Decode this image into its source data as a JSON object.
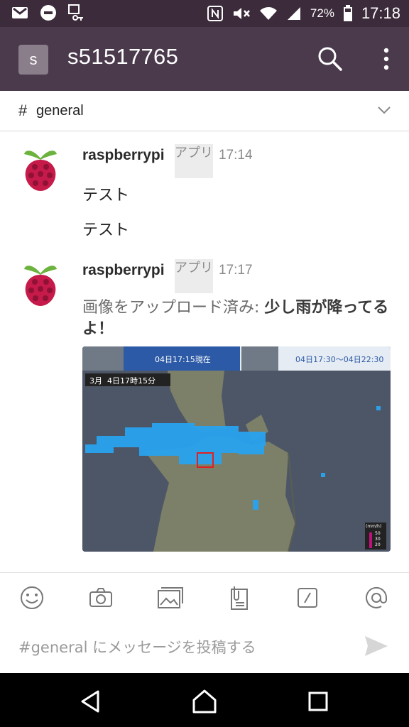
{
  "status_bar": {
    "battery": "72%",
    "time": "17:18"
  },
  "app_bar": {
    "team_initial": "s",
    "team_name": "s51517765"
  },
  "channel": {
    "hash": "#",
    "name": "general"
  },
  "messages": [
    {
      "author": "raspberrypi",
      "tag": "アプリ",
      "time": "17:14",
      "lines": [
        "テスト",
        "テスト"
      ]
    },
    {
      "author": "raspberrypi",
      "tag": "アプリ",
      "time": "17:17",
      "upload_prefix": "画像をアップロード済み: ",
      "upload_title": "少し雨が降ってるよ！",
      "image": {
        "tab1_time": "04日17:15現在",
        "tab2_time": "04日17:30〜04日22:30",
        "timestamp": "3月  4日17時15分",
        "legend_unit": "(mm/h)",
        "legend_values": [
          "50",
          "30",
          "20"
        ]
      }
    }
  ],
  "composer": {
    "placeholder": "#general にメッセージを投稿する"
  },
  "colors": {
    "status_bar": "#3b2b3b",
    "app_bar": "#4a3a4c",
    "team_badge": "#8b7e8b"
  }
}
